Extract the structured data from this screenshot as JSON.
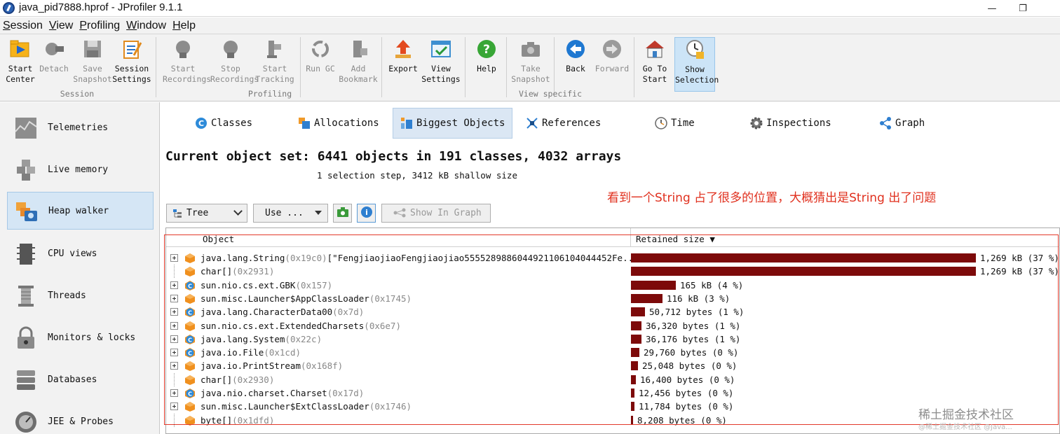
{
  "window": {
    "title": "java_pid7888.hprof - JProfiler 9.1.1",
    "minimize": "—",
    "restore": "❐"
  },
  "menu": [
    "Session",
    "View",
    "Profiling",
    "Window",
    "Help"
  ],
  "toolbar": {
    "tools": [
      {
        "label": "Start\nCenter",
        "icon": "start-center-icon",
        "disabled": false
      },
      {
        "label": "Detach",
        "icon": "detach-icon",
        "disabled": true
      },
      {
        "label": "Save\nSnapshot",
        "icon": "save-snapshot-icon",
        "disabled": true
      },
      {
        "label": "Session\nSettings",
        "icon": "session-settings-icon",
        "disabled": false
      },
      {
        "label": "Start\nRecordings",
        "icon": "start-recordings-icon",
        "disabled": true
      },
      {
        "label": "Stop\nRecordings",
        "icon": "stop-recordings-icon",
        "disabled": true
      },
      {
        "label": "Start\nTracking",
        "icon": "start-tracking-icon",
        "disabled": true
      },
      {
        "label": "Run GC",
        "icon": "run-gc-icon",
        "disabled": true
      },
      {
        "label": "Add\nBookmark",
        "icon": "add-bookmark-icon",
        "disabled": true
      },
      {
        "label": "Export",
        "icon": "export-icon",
        "disabled": false
      },
      {
        "label": "View\nSettings",
        "icon": "view-settings-icon",
        "disabled": false
      },
      {
        "label": "Help",
        "icon": "help-icon",
        "disabled": false
      },
      {
        "label": "Take\nSnapshot",
        "icon": "take-snapshot-icon",
        "disabled": true
      },
      {
        "label": "Back",
        "icon": "back-icon",
        "disabled": false
      },
      {
        "label": "Forward",
        "icon": "forward-icon",
        "disabled": true
      },
      {
        "label": "Go To\nStart",
        "icon": "go-to-start-icon",
        "disabled": false
      },
      {
        "label": "Show\nSelection",
        "icon": "show-selection-icon",
        "disabled": false,
        "selected": true
      }
    ],
    "groups": [
      "Session",
      "Profiling",
      "View specific"
    ]
  },
  "sidebar": {
    "items": [
      {
        "label": "Telemetries",
        "icon": "telemetries-icon"
      },
      {
        "label": "Live memory",
        "icon": "live-memory-icon"
      },
      {
        "label": "Heap walker",
        "icon": "heap-walker-icon",
        "selected": true
      },
      {
        "label": "CPU views",
        "icon": "cpu-views-icon"
      },
      {
        "label": "Threads",
        "icon": "threads-icon"
      },
      {
        "label": "Monitors & locks",
        "icon": "monitors-locks-icon"
      },
      {
        "label": "Databases",
        "icon": "databases-icon"
      },
      {
        "label": "JEE & Probes",
        "icon": "jee-probes-icon"
      }
    ]
  },
  "view_tabs": [
    {
      "label": "Classes",
      "icon": "classes-icon"
    },
    {
      "label": "Allocations",
      "icon": "allocations-icon"
    },
    {
      "label": "Biggest Objects",
      "icon": "biggest-objects-icon",
      "selected": true
    },
    {
      "label": "References",
      "icon": "references-icon"
    },
    {
      "label": "Time",
      "icon": "time-icon"
    },
    {
      "label": "Inspections",
      "icon": "inspections-icon"
    },
    {
      "label": "Graph",
      "icon": "graph-icon"
    }
  ],
  "heading": "Current object set: 6441 objects in 191 classes, 4032 arrays",
  "subheading": "1 selection step, 3412 kB shallow size",
  "annotation": "看到一个String 占了很多的位置，大概猜出是String 出了问题",
  "controls": {
    "view_mode": "Tree",
    "use_button": "Use ...",
    "show_in_graph": "Show In Graph"
  },
  "table": {
    "columns": {
      "object": "Object",
      "retained": "Retained size"
    },
    "sort_indicator": "▼",
    "rows": [
      {
        "name": "java.lang.String",
        "id": "(0x19c0)",
        "extra": "[\"FengjiaojiaoFengjiaojiao5555289886044921106104044452Fe...",
        "kind": "instance",
        "expand": true,
        "size": "1,269 kB (37 %)",
        "fraction": 0.37
      },
      {
        "name": "char[]",
        "id": "(0x2931)",
        "extra": "",
        "kind": "array",
        "expand": false,
        "size": "1,269 kB (37 %)",
        "fraction": 0.37
      },
      {
        "name": "sun.nio.cs.ext.GBK",
        "id": "(0x157)",
        "extra": "",
        "kind": "class",
        "expand": true,
        "size": "165 kB (4 %)",
        "fraction": 0.048
      },
      {
        "name": "sun.misc.Launcher$AppClassLoader",
        "id": "(0x1745)",
        "extra": "",
        "kind": "instance",
        "expand": true,
        "size": "116 kB (3 %)",
        "fraction": 0.034
      },
      {
        "name": "java.lang.CharacterData00",
        "id": "(0x7d)",
        "extra": "",
        "kind": "class",
        "expand": true,
        "size": "50,712 bytes (1 %)",
        "fraction": 0.015
      },
      {
        "name": "sun.nio.cs.ext.ExtendedCharsets",
        "id": "(0x6e7)",
        "extra": "",
        "kind": "instance",
        "expand": true,
        "size": "36,320 bytes (1 %)",
        "fraction": 0.011
      },
      {
        "name": "java.lang.System",
        "id": "(0x22c)",
        "extra": "",
        "kind": "class",
        "expand": true,
        "size": "36,176 bytes (1 %)",
        "fraction": 0.011
      },
      {
        "name": "java.io.File",
        "id": "(0x1cd)",
        "extra": "",
        "kind": "class",
        "expand": true,
        "size": "29,760 bytes (0 %)",
        "fraction": 0.009
      },
      {
        "name": "java.io.PrintStream",
        "id": "(0x168f)",
        "extra": "",
        "kind": "instance",
        "expand": true,
        "size": "25,048 bytes (0 %)",
        "fraction": 0.0075
      },
      {
        "name": "char[]",
        "id": "(0x2930)",
        "extra": "",
        "kind": "array",
        "expand": false,
        "size": "16,400 bytes (0 %)",
        "fraction": 0.005
      },
      {
        "name": "java.nio.charset.Charset",
        "id": "(0x17d)",
        "extra": "",
        "kind": "class",
        "expand": true,
        "size": "12,456 bytes (0 %)",
        "fraction": 0.0037
      },
      {
        "name": "sun.misc.Launcher$ExtClassLoader",
        "id": "(0x1746)",
        "extra": "",
        "kind": "instance",
        "expand": true,
        "size": "11,784 bytes (0 %)",
        "fraction": 0.0035
      },
      {
        "name": "byte[]",
        "id": "(0x1dfd)",
        "extra": "",
        "kind": "array",
        "expand": false,
        "size": "8,208 bytes (0 %)",
        "fraction": 0.0025
      }
    ]
  },
  "watermark": "稀土掘金技术社区",
  "watermark_sub": "@稀土掘金技术社区 @Java..."
}
